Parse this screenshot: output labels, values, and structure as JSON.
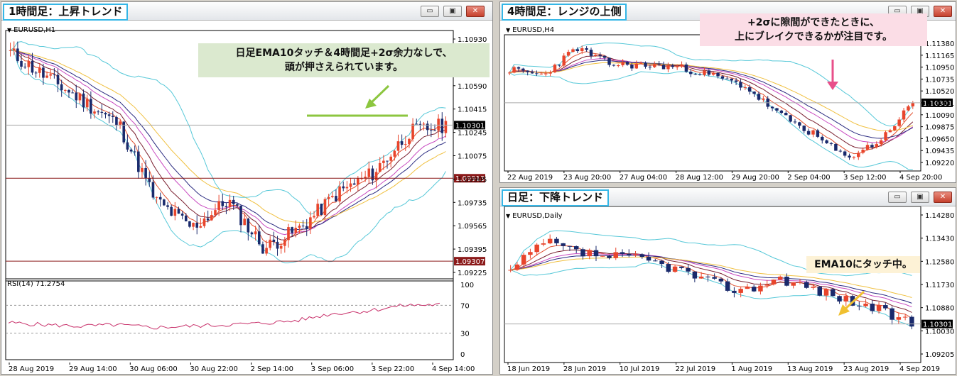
{
  "windows": {
    "h1": {
      "title": "1時間足：上昇トレンド",
      "symbol": "EURUSD,H1",
      "price_ticks": [
        "1.10930",
        "1.10760",
        "1.10590",
        "1.10415",
        "1.10245",
        "1.10075",
        "1.09905",
        "1.09735",
        "1.09565",
        "1.09395",
        "1.09225"
      ],
      "current_price": "1.10301",
      "level_high": "1.09913",
      "level_low": "1.09307",
      "annotation": "日足EMA10タッチ＆4時間足+2σ余力なしで、\n頭が押さえられています。",
      "rsi_label": "RSI(14) 71.2754",
      "rsi_ticks": [
        "100",
        "70",
        "30",
        "0"
      ],
      "time_ticks": [
        "28 Aug 2019",
        "29 Aug 14:00",
        "30 Aug 06:00",
        "30 Aug 22:00",
        "2 Sep 14:00",
        "3 Sep 06:00",
        "3 Sep 22:00",
        "4 Sep 14:00"
      ]
    },
    "h4": {
      "title": "4時間足：レンジの上側",
      "symbol": "EURUSD,H4",
      "price_ticks": [
        "1.11380",
        "1.11165",
        "1.10950",
        "1.10735",
        "1.10520",
        "1.10301",
        "1.10090",
        "1.09875",
        "1.09650",
        "1.09435",
        "1.09220"
      ],
      "current_price": "1.10301",
      "annotation": "+2σに隙間ができたときに、\n上にブレイクできるかが注目です。",
      "time_ticks": [
        "22 Aug 2019",
        "23 Aug 20:00",
        "27 Aug 04:00",
        "28 Aug 12:00",
        "29 Aug 20:00",
        "2 Sep 04:00",
        "3 Sep 12:00",
        "4 Sep 20:00"
      ]
    },
    "daily": {
      "title": "日足：下降トレンド",
      "symbol": "EURUSD,Daily",
      "price_ticks": [
        "1.14280",
        "1.13430",
        "1.12580",
        "1.11730",
        "1.10880",
        "1.10030",
        "1.09205"
      ],
      "current_price": "1.10301",
      "annotation": "EMA10にタッチ中。",
      "time_ticks": [
        "18 Jun 2019",
        "28 Jun 2019",
        "10 Jul 2019",
        "22 Jul 2019",
        "1 Aug 2019",
        "13 Aug 2019",
        "23 Aug 2019",
        "4 Sep 2019"
      ]
    }
  },
  "colors": {
    "bull": "#e8452c",
    "bear": "#1a2a6c",
    "ema_fast": "#e05030",
    "ema_mid": "#7a2030",
    "ema_slow": "#c84ac0",
    "ema_base": "#2a2a80",
    "ema_long": "#f0c040",
    "bollinger": "#56c8d8",
    "level_line": "#8b1a1a",
    "rsi": "#c8306a",
    "arrow_green": "#8cc63f",
    "arrow_pink": "#e8508a",
    "arrow_yellow": "#f0c030"
  },
  "buttons": {
    "minimize": "▭",
    "restore": "▣",
    "close": "✕"
  }
}
